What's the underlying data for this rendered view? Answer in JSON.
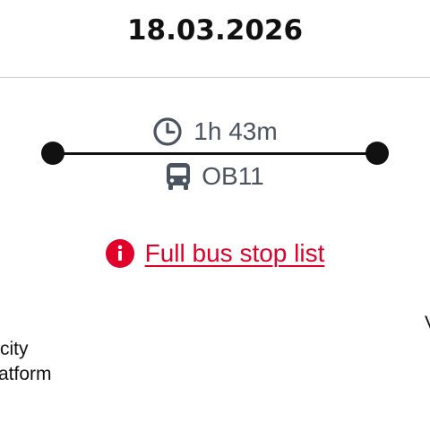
{
  "header": {
    "date": "18.03.2026"
  },
  "journey": {
    "duration": "1h 43m",
    "bus_number": "OB11",
    "duration_icon": "clock-icon",
    "bus_icon": "bus-icon"
  },
  "stop_list": {
    "label": "Full bus stop list",
    "icon": "info-icon"
  },
  "departure_stop": {
    "line1": "city",
    "line2": "atform"
  },
  "arrival_stop": {
    "line1": "V"
  },
  "colors": {
    "accent": "#e0002a",
    "text_secondary": "#4a5460",
    "text_primary": "#111111"
  }
}
